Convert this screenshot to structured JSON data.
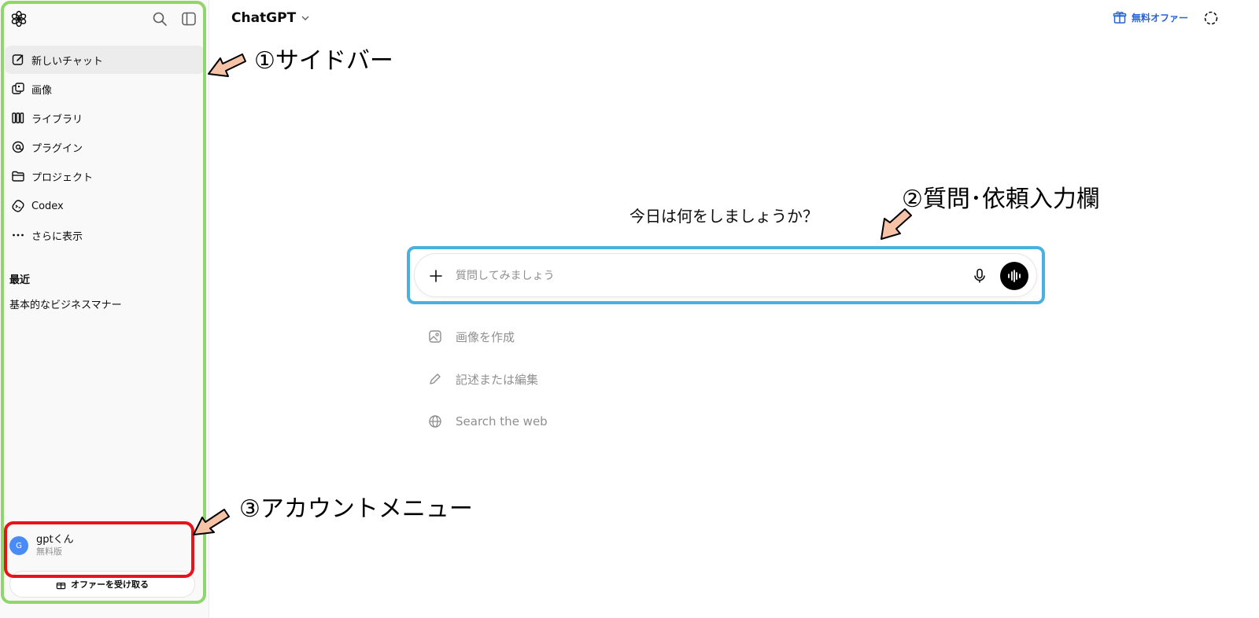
{
  "sidebar": {
    "nav": [
      {
        "label": "新しいチャット",
        "icon": "new-chat-icon"
      },
      {
        "label": "画像",
        "icon": "images-icon"
      },
      {
        "label": "ライブラリ",
        "icon": "library-icon"
      },
      {
        "label": "プラグイン",
        "icon": "plugins-icon"
      },
      {
        "label": "プロジェクト",
        "icon": "folder-icon"
      },
      {
        "label": "Codex",
        "icon": "codex-icon"
      },
      {
        "label": "さらに表示",
        "icon": "more-icon"
      }
    ],
    "recent_title": "最近",
    "recent": [
      "基本的なビジネスマナー"
    ],
    "account": {
      "initial": "G",
      "name": "gptくん",
      "plan": "無料版"
    },
    "offer_button": "オファーを受け取る"
  },
  "header": {
    "model": "ChatGPT",
    "free_offer": "無料オファー"
  },
  "main": {
    "greeting": "今日は何をしましょうか？",
    "placeholder": "質問してみましょう",
    "suggestions": [
      {
        "label": "画像を作成",
        "icon": "image-create-icon"
      },
      {
        "label": "記述または編集",
        "icon": "pencil-icon"
      },
      {
        "label": "Search the web",
        "icon": "globe-icon"
      }
    ]
  },
  "annotations": {
    "sidebar": "①サイドバー",
    "input": "②質問･依頼入力欄",
    "account": "③アカウントメニュー"
  },
  "colors": {
    "sidebar_highlight": "#8fd66b",
    "input_highlight": "#4ab0de",
    "account_highlight": "#e8141b",
    "arrow_fill": "#f6c3a6",
    "accent": "#2864d6"
  }
}
